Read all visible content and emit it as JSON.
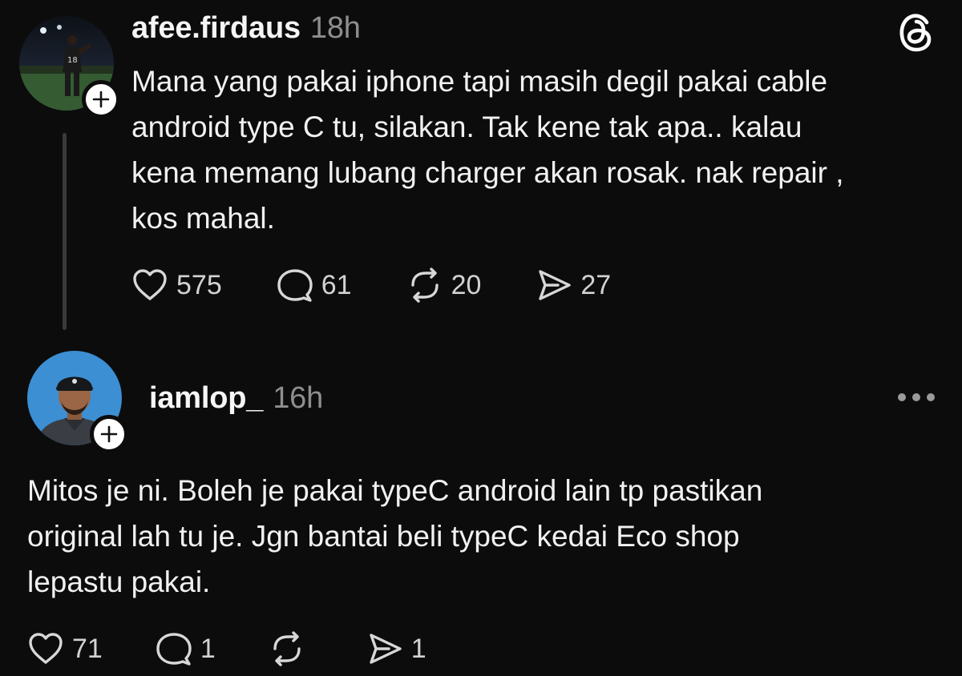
{
  "post": {
    "username": "afee.firdaus",
    "time": "18h",
    "text": "Mana yang pakai iphone tapi masih degil pakai cable\nandroid type C tu, silakan. Tak kene tak apa.. kalau\nkena memang lubang charger akan rosak. nak repair ,\nkos mahal.",
    "likes": "575",
    "replies": "61",
    "reposts": "20",
    "shares": "27"
  },
  "reply": {
    "username": "iamlop_",
    "time": "16h",
    "text": "Mitos je ni. Boleh je pakai typeC android lain tp pastikan\noriginal lah tu je. Jgn bantai beli typeC kedai Eco shop\nlepastu pakai.",
    "likes": "71",
    "replies": "1",
    "reposts": "",
    "shares": "1"
  },
  "icons": {
    "app_logo": "threads-logo-icon",
    "follow": "plus-icon",
    "like": "heart-icon",
    "reply": "comment-icon",
    "repost": "repost-icon",
    "share": "send-icon",
    "more": "more-options-icon"
  },
  "colors": {
    "background": "#0c0c0c",
    "text": "#f3f3f3",
    "muted": "#8e8e8e",
    "thread_line": "#3a3a3a",
    "reply_avatar_bg": "#3d8fd4"
  }
}
